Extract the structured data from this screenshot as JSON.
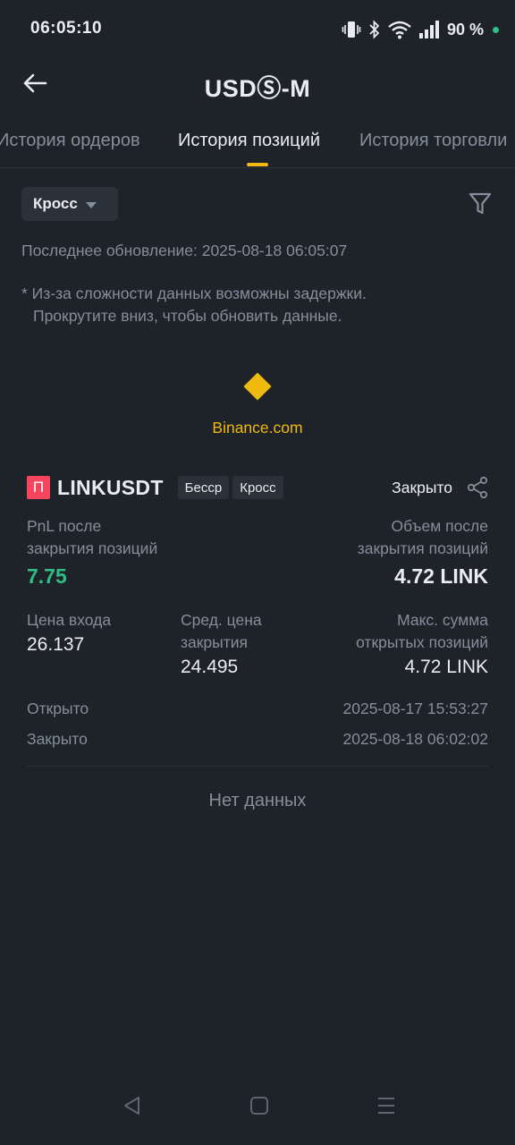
{
  "status_bar": {
    "time": "06:05:10",
    "battery": "90 %"
  },
  "header": {
    "title": "USDⓈ-M"
  },
  "tabs": [
    {
      "label": "История ордеров",
      "active": false
    },
    {
      "label": "История позиций",
      "active": true
    },
    {
      "label": "История торговли",
      "active": false
    }
  ],
  "filter": {
    "margin_mode": "Кросс"
  },
  "last_update": "Последнее обновление: 2025-08-18 06:05:07",
  "note": {
    "line1": "* Из-за сложности данных возможны задержки.",
    "line2": "Прокрутите вниз, чтобы обновить данные."
  },
  "watermark": {
    "text": "Binance.com"
  },
  "position": {
    "badge": "П",
    "symbol": "LINKUSDT",
    "tags": [
      "Бесср",
      "Кросс"
    ],
    "status": "Закрыто",
    "pnl_label_1": "PnL после",
    "pnl_label_2": "закрытия позиций",
    "pnl_value": "7.75",
    "volume_label_1": "Объем после",
    "volume_label_2": "закрытия позиций",
    "volume_value": "4.72 LINK",
    "entry_label": "Цена входа",
    "entry_value": "26.137",
    "close_label_1": "Сред. цена",
    "close_label_2": "закрытия",
    "close_value": "24.495",
    "max_label_1": "Макс. сумма",
    "max_label_2": "открытых позиций",
    "max_value": "4.72 LINK",
    "opened_label": "Открыто",
    "opened_value": "2025-08-17 15:53:27",
    "closed_label": "Закрыто",
    "closed_value": "2025-08-18 06:02:02"
  },
  "empty_state": "Нет данных",
  "colors": {
    "background": "#1e2329",
    "accent": "#f0b90b",
    "profit": "#2ebd85",
    "loss_badge": "#f6465d",
    "muted": "#848e9c"
  }
}
